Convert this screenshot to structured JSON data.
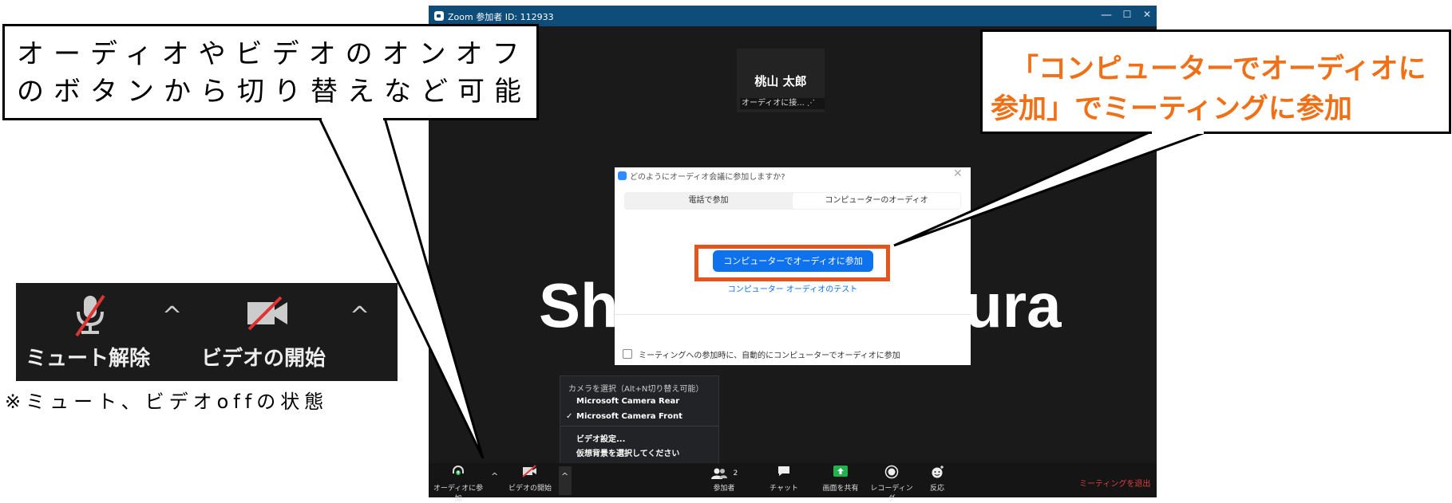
{
  "window": {
    "title": "Zoom 参加者 ID: 112933",
    "controls": {
      "minimize": "—",
      "maximize": "☐",
      "close": "✕"
    }
  },
  "speaker": {
    "name": "桃山 太郎",
    "status": "オーディオに接... ⋰"
  },
  "share_text": "Sh                    ura",
  "dialog": {
    "title": "どのようにオーディオ会議に参加しますか?",
    "close": "✕",
    "tabs": [
      "電話で参加",
      "コンピューターのオーディオ"
    ],
    "join_button": "コンピューターでオーディオに参加",
    "test_link": "コンピューター オーディオのテスト",
    "auto_join_label": "ミーティングへの参加時に、自動的にコンピューターでオーディオに参加"
  },
  "camera_menu": {
    "header": "カメラを選択（Alt+N切り替え可能）",
    "cameras": [
      "Microsoft Camera Rear",
      "Microsoft Camera Front"
    ],
    "selected_mark": "✓",
    "video_settings": "ビデオ設定...",
    "virtual_bg": "仮想背景を選択してください"
  },
  "toolbar": {
    "audio": "オーディオに参加",
    "video": "ビデオの開始",
    "participants": "参加者",
    "participant_count": "2",
    "chat": "チャット",
    "share": "画面を共有",
    "record": "レコーディング",
    "reactions": "反応",
    "leave": "ミーティングを退出",
    "caret": "^"
  },
  "callouts": {
    "left": "オーディオやビデオのオンオフのボタンから切り替えなど可能",
    "right_line1": "「コンピューターでオーディオに",
    "right_line2": "参加」でミーティングに参加"
  },
  "inset": {
    "mute_label": "ミュート解除",
    "video_label": "ビデオの開始",
    "caret": "^",
    "caption": "※ミュート、ビデオoffの状態"
  },
  "colors": {
    "accent_orange": "#f07018",
    "highlight_orange": "#e4541c",
    "zoom_blue": "#0e72ed",
    "leave_red": "#e03e3e"
  }
}
